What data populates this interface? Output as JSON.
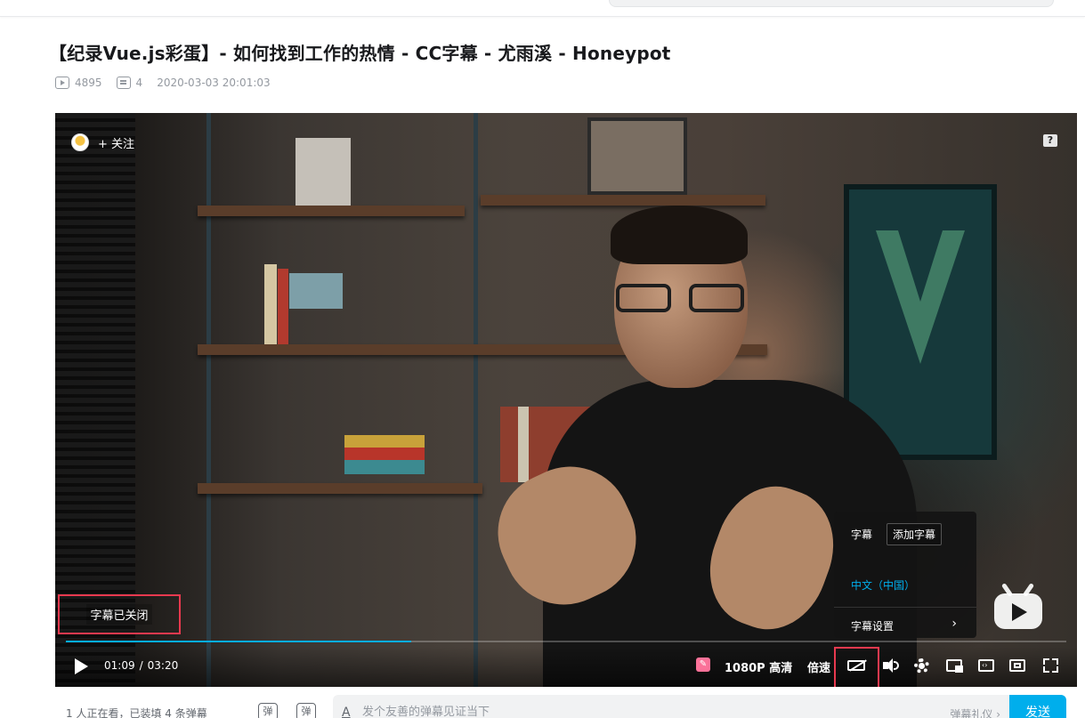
{
  "video": {
    "title": "【纪录Vue.js彩蛋】- 如何找到工作的热情 - CC字幕 - 尤雨溪 - Honeypot",
    "views": "4895",
    "danmaku_count": "4",
    "published": "2020-03-03 20:01:03"
  },
  "player": {
    "follow_label": "+ 关注",
    "help_label": "?",
    "subtitle_toast": "字幕已关闭",
    "current_time": "01:09",
    "time_separator": "/",
    "duration": "03:20",
    "progress_fraction": 0.345,
    "buffered_fraction": 0.345,
    "quality_label": "1080P 高清",
    "speed_label": "倍速",
    "subtitle_menu": {
      "header": "字幕",
      "add_button": "添加字幕",
      "language_option": "中文（中国）",
      "settings_label": "字幕设置",
      "settings_chevron": "›"
    },
    "accent_color": "#00aeec",
    "highlight_color": "#e8394f"
  },
  "danmaku_bar": {
    "viewers_text": "1 人正在看，已装填 4 条弹幕",
    "toggle_label": "弹",
    "settings_label": "弹",
    "placeholder": "发个友善的弹幕见证当下",
    "etiquette_link": "弹幕礼仪 ›",
    "send_label": "发送"
  },
  "icons": [
    "play-icon",
    "subtitle-off-icon",
    "volume-icon",
    "settings-icon",
    "pip-icon",
    "widescreen-icon",
    "webfullscreen-icon",
    "fullscreen-icon",
    "bilibili-tv-logo"
  ]
}
